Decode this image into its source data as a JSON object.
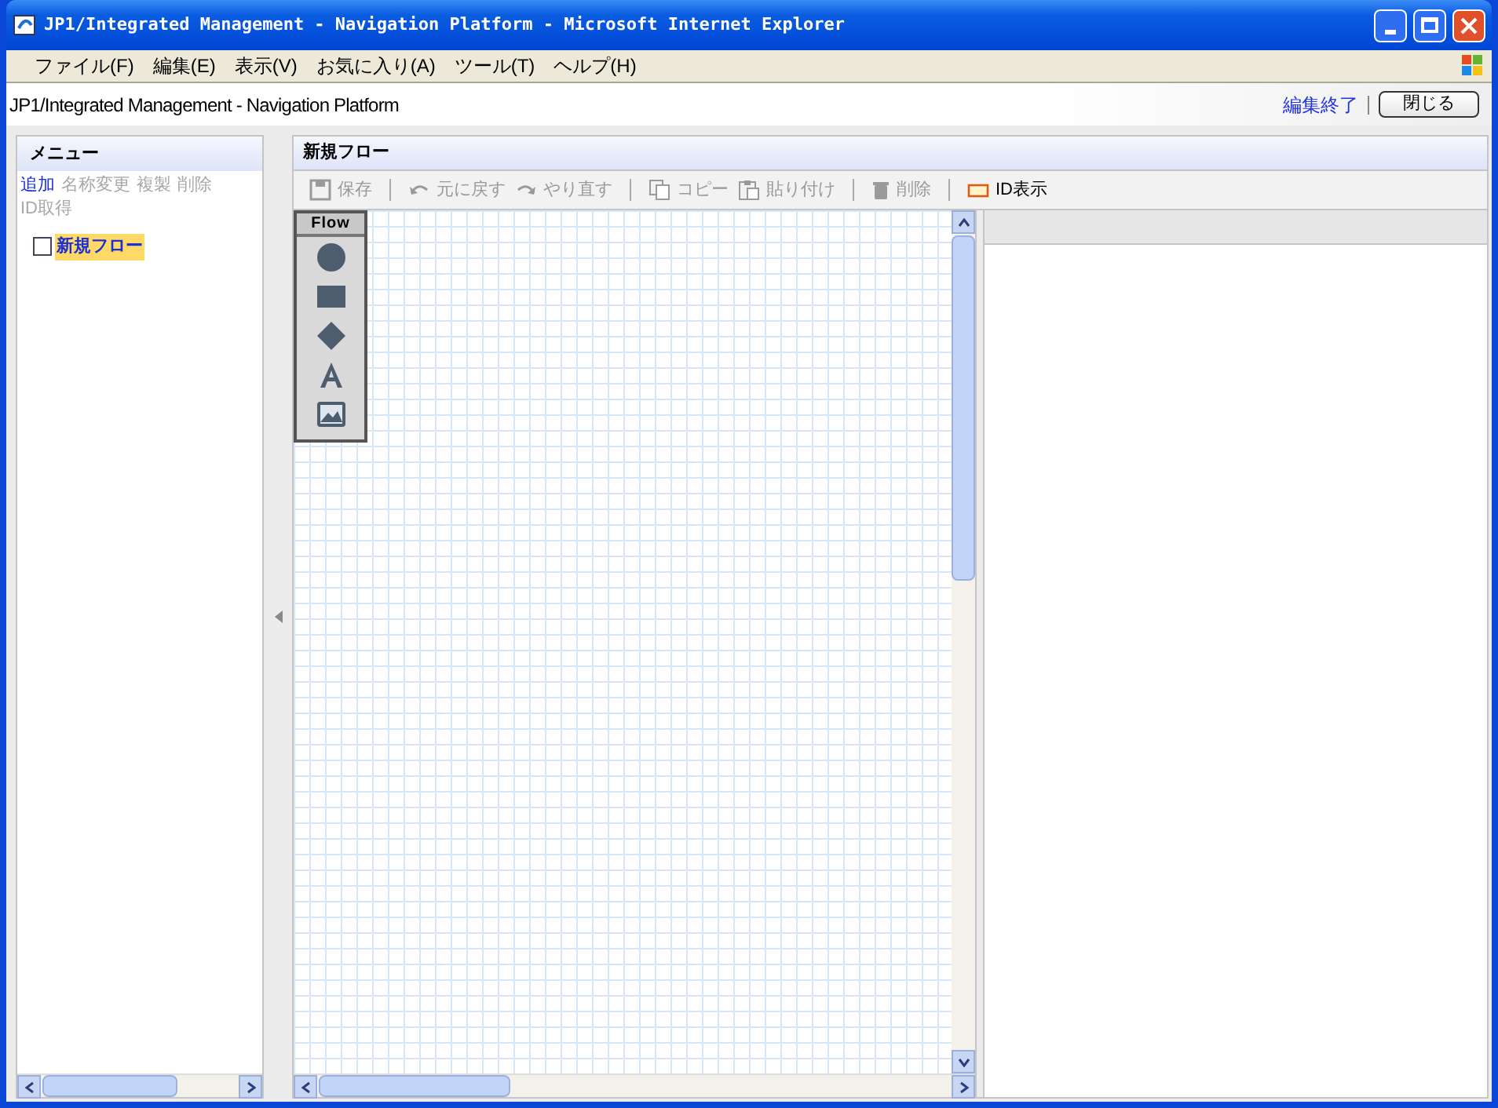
{
  "window": {
    "title": "JP1/Integrated Management - Navigation Platform - Microsoft Internet Explorer"
  },
  "menu_bar": [
    "ファイル(F)",
    "編集(E)",
    "表示(V)",
    "お気に入り(A)",
    "ツール(T)",
    "ヘルプ(H)"
  ],
  "app_header": {
    "title": "JP1/Integrated Management - Navigation Platform",
    "link": "編集終了",
    "button": "閉じる"
  },
  "menu_panel": {
    "title": "メニュー",
    "actions": [
      {
        "label": "追加",
        "disabled": false
      },
      {
        "label": "名称変更",
        "disabled": true
      },
      {
        "label": "複製",
        "disabled": true
      },
      {
        "label": "削除",
        "disabled": true
      },
      {
        "label": "ID取得",
        "disabled": true
      }
    ],
    "tree": [
      {
        "label": "新規フロー",
        "selected": true,
        "checked": false
      }
    ]
  },
  "editor": {
    "title": "新規フロー",
    "toolbar": [
      {
        "kind": "save",
        "label": "保存",
        "disabled": true
      },
      {
        "kind": "separator"
      },
      {
        "kind": "undo",
        "label": "元に戻す",
        "disabled": true
      },
      {
        "kind": "redo",
        "label": "やり直す",
        "disabled": true
      },
      {
        "kind": "separator"
      },
      {
        "kind": "copy",
        "label": "コピー",
        "disabled": true
      },
      {
        "kind": "paste",
        "label": "貼り付け",
        "disabled": true
      },
      {
        "kind": "separator"
      },
      {
        "kind": "delete",
        "label": "削除",
        "disabled": true
      },
      {
        "kind": "separator"
      },
      {
        "kind": "id",
        "label": "ID表示",
        "disabled": false
      }
    ],
    "palette": {
      "title": "Flow",
      "tools": [
        {
          "kind": "circle"
        },
        {
          "kind": "rectangle"
        },
        {
          "kind": "diamond"
        },
        {
          "kind": "text"
        },
        {
          "kind": "image"
        }
      ]
    }
  }
}
